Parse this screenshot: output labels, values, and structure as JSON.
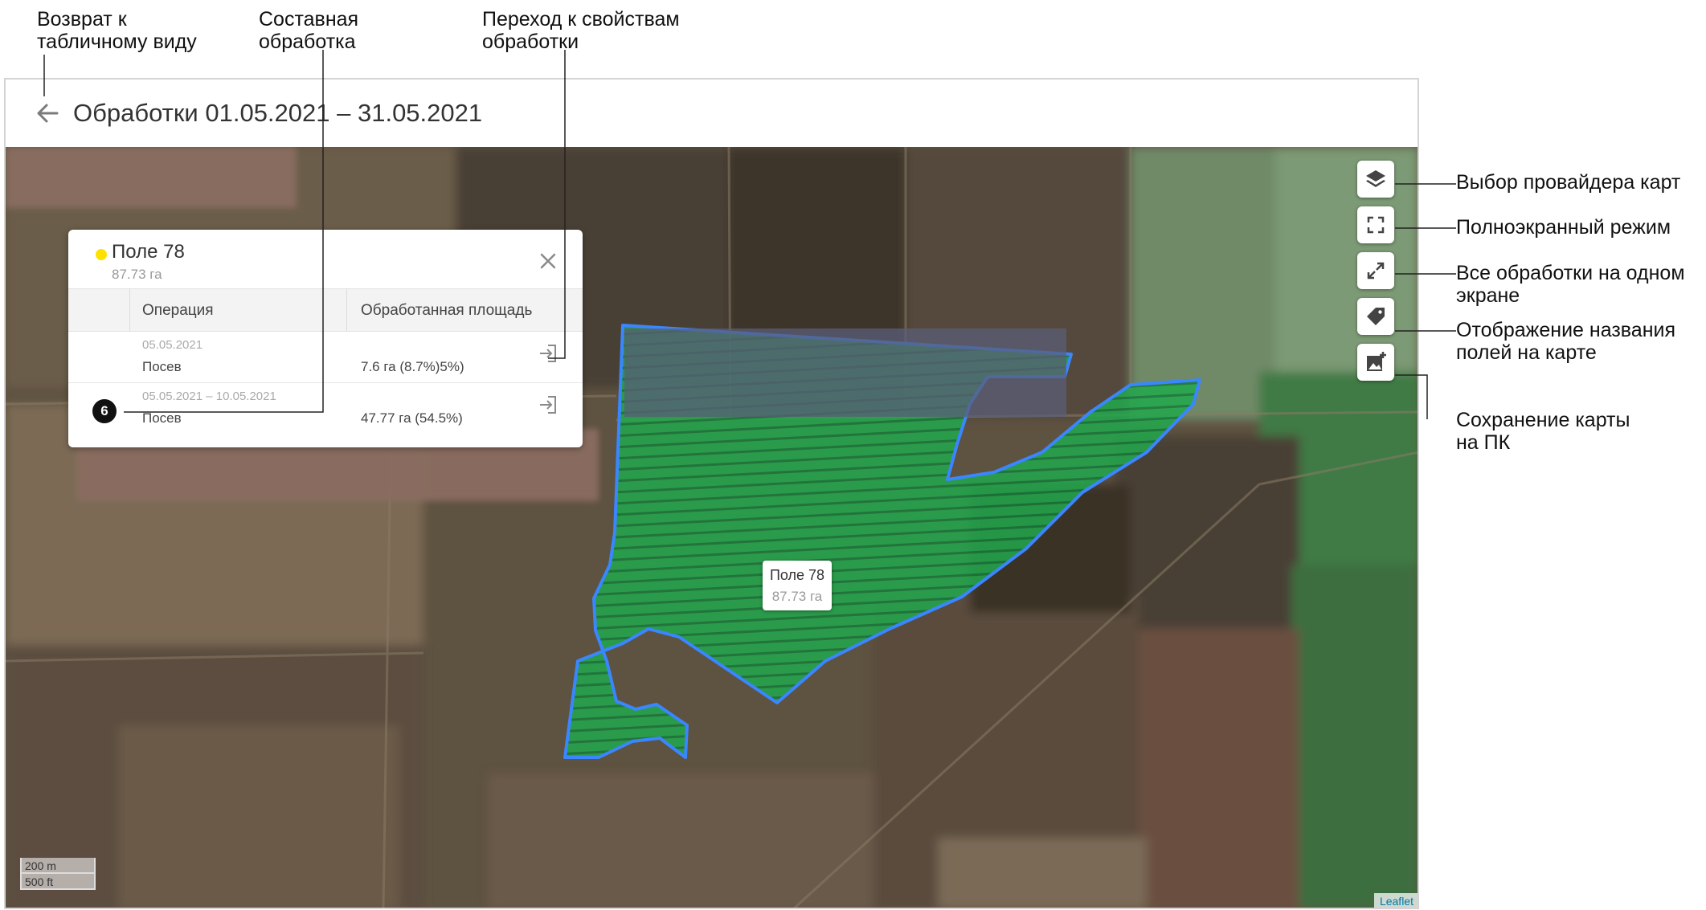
{
  "annotations": {
    "back_to_table": "Возврат к\nтабличному виду",
    "composite_processing": "Составная\nобработка",
    "goto_properties": "Переход к свойствам\nобработки",
    "map_provider": "Выбор провайдера  карт",
    "fullscreen": "Полноэкранный режим",
    "all_on_screen": "Все обработки на одном\nэкране",
    "show_field_names": "Отображение названия\nполей на карте",
    "save_map": "Сохранение карты\nна ПК"
  },
  "header": {
    "title": "Обработки 01.05.2021 – 31.05.2021"
  },
  "popup": {
    "field_name": "Поле 78",
    "field_area": "87.73 га",
    "columns": {
      "operation": "Операция",
      "processed_area": "Обработанная площадь"
    },
    "rows": [
      {
        "date": "05.05.2021",
        "operation": "Посев",
        "area": "7.6 га (8.7%)5%)",
        "badge": ""
      },
      {
        "date": "05.05.2021 – 10.05.2021",
        "operation": "Посев",
        "area": "47.77 га (54.5%)",
        "badge": "6"
      }
    ]
  },
  "map_label": {
    "name": "Поле 78",
    "area": "87.73 га"
  },
  "scale": {
    "metric": "200 m",
    "imperial": "500 ft"
  },
  "attribution": "Leaflet",
  "colors": {
    "field_outline": "#3a86ff",
    "field_fill": "#1fa84a",
    "field_dot": "#ffe100",
    "accent_tick": "#e53935"
  },
  "icons": {
    "back": "arrow-left-icon",
    "close": "close-icon",
    "goto": "login-arrow-icon",
    "layers": "layers-icon",
    "fullscreen": "fullscreen-icon",
    "fit_all": "expand-arrows-icon",
    "labels": "tag-icon",
    "save": "image-save-icon"
  }
}
